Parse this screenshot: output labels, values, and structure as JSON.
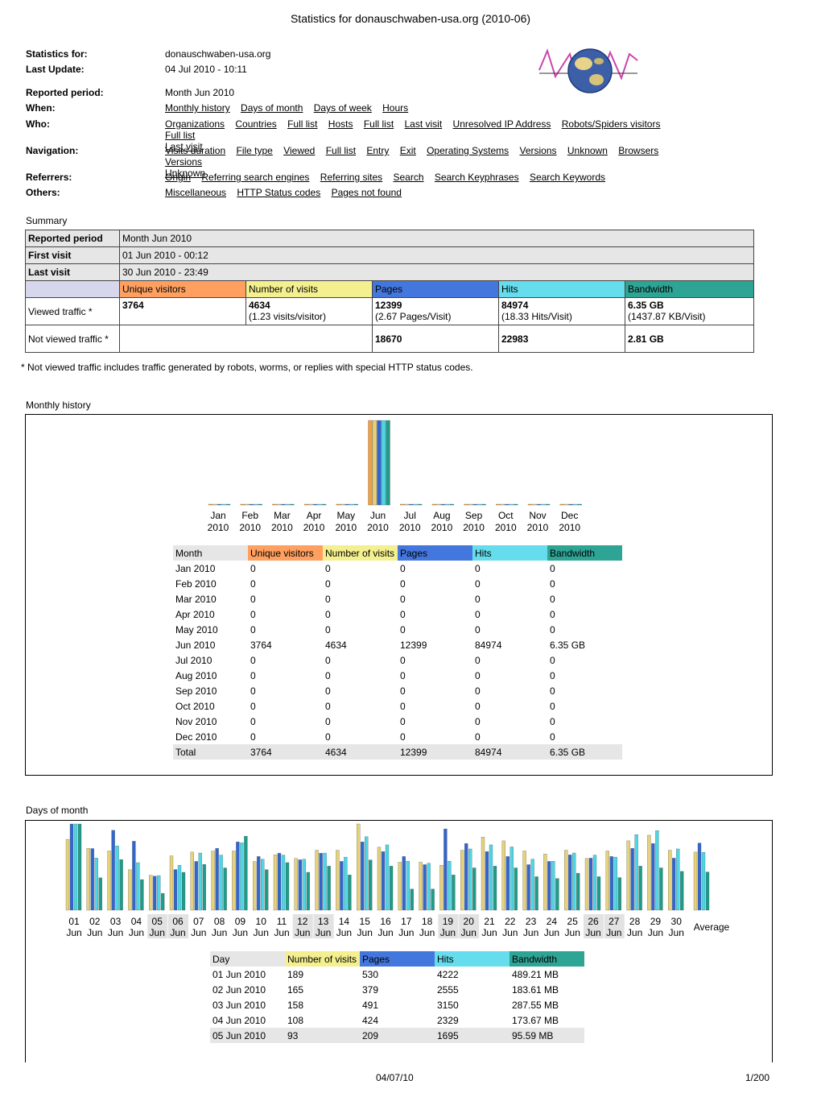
{
  "doc_title": "Statistics for donauschwaben-usa.org (2010-06)",
  "info": {
    "stats_for_label": "Statistics for:",
    "stats_for_value": "donauschwaben-usa.org",
    "last_update_label": "Last Update:",
    "last_update_value": "04 Jul 2010 - 10:11",
    "reported_period_label": "Reported period:",
    "reported_period_value": "Month Jun 2010",
    "when_label": "When:",
    "who_label": "Who:",
    "navigation_label": "Navigation:",
    "referrers_label": "Referrers:",
    "others_label": "Others:"
  },
  "nav": {
    "when": [
      "Monthly history",
      "Days of month",
      "Days of week",
      "Hours"
    ],
    "who": [
      "Organizations",
      "Countries",
      "Full list",
      "Hosts",
      "Full list",
      "Last visit",
      "Unresolved IP Address",
      "Robots/Spiders visitors",
      "Full list",
      "Last visit"
    ],
    "navigation": [
      "Visits duration",
      "File type",
      "Viewed",
      "Full list",
      "Entry",
      "Exit",
      "Operating Systems",
      "Versions",
      "Unknown",
      "Browsers",
      "Versions",
      "Unknown"
    ],
    "referrers": [
      "Origin",
      "Referring search engines",
      "Referring sites",
      "Search",
      "Search Keyphrases",
      "Search Keywords"
    ],
    "others": [
      "Miscellaneous",
      "HTTP Status codes",
      "Pages not found"
    ]
  },
  "summary": {
    "title": "Summary",
    "reported_period_label": "Reported period",
    "reported_period_value": "Month Jun 2010",
    "first_visit_label": "First visit",
    "first_visit_value": "01 Jun 2010 - 00:12",
    "last_visit_label": "Last visit",
    "last_visit_value": "30 Jun 2010 - 23:49",
    "col_uv": "Unique visitors",
    "col_visits": "Number of visits",
    "col_pages": "Pages",
    "col_hits": "Hits",
    "col_bw": "Bandwidth",
    "viewed_label": "Viewed traffic *",
    "viewed": {
      "uv": "3764",
      "visits": "4634",
      "visits_sub": "(1.23 visits/visitor)",
      "pages": "12399",
      "pages_sub": "(2.67 Pages/Visit)",
      "hits": "84974",
      "hits_sub": "(18.33 Hits/Visit)",
      "bw": "6.35 GB",
      "bw_sub": "(1437.87 KB/Visit)"
    },
    "not_viewed_label": "Not viewed traffic *",
    "not_viewed": {
      "pages": "18670",
      "hits": "22983",
      "bw": "2.81 GB"
    },
    "note": "* Not viewed traffic includes traffic generated by robots, worms, or replies with special HTTP status codes."
  },
  "monthly": {
    "title": "Monthly history",
    "headers": [
      "Month",
      "Unique visitors",
      "Number of visits",
      "Pages",
      "Hits",
      "Bandwidth"
    ],
    "rows": [
      [
        "Jan 2010",
        "0",
        "0",
        "0",
        "0",
        "0"
      ],
      [
        "Feb 2010",
        "0",
        "0",
        "0",
        "0",
        "0"
      ],
      [
        "Mar 2010",
        "0",
        "0",
        "0",
        "0",
        "0"
      ],
      [
        "Apr 2010",
        "0",
        "0",
        "0",
        "0",
        "0"
      ],
      [
        "May 2010",
        "0",
        "0",
        "0",
        "0",
        "0"
      ],
      [
        "Jun 2010",
        "3764",
        "4634",
        "12399",
        "84974",
        "6.35 GB"
      ],
      [
        "Jul 2010",
        "0",
        "0",
        "0",
        "0",
        "0"
      ],
      [
        "Aug 2010",
        "0",
        "0",
        "0",
        "0",
        "0"
      ],
      [
        "Sep 2010",
        "0",
        "0",
        "0",
        "0",
        "0"
      ],
      [
        "Oct 2010",
        "0",
        "0",
        "0",
        "0",
        "0"
      ],
      [
        "Nov 2010",
        "0",
        "0",
        "0",
        "0",
        "0"
      ],
      [
        "Dec 2010",
        "0",
        "0",
        "0",
        "0",
        "0"
      ]
    ],
    "total": [
      "Total",
      "3764",
      "4634",
      "12399",
      "84974",
      "6.35 GB"
    ]
  },
  "days": {
    "title": "Days of month",
    "average_label": "Average",
    "headers": [
      "Day",
      "Number of visits",
      "Pages",
      "Hits",
      "Bandwidth"
    ],
    "rows": [
      [
        "01 Jun 2010",
        "189",
        "530",
        "4222",
        "489.21 MB"
      ],
      [
        "02 Jun 2010",
        "165",
        "379",
        "2555",
        "183.61 MB"
      ],
      [
        "03 Jun 2010",
        "158",
        "491",
        "3150",
        "287.55 MB"
      ],
      [
        "04 Jun 2010",
        "108",
        "424",
        "2329",
        "173.67 MB"
      ],
      [
        "05 Jun 2010",
        "93",
        "209",
        "1695",
        "95.59 MB"
      ]
    ]
  },
  "chart_data": [
    {
      "type": "bar",
      "categories": [
        "Jan 2010",
        "Feb 2010",
        "Mar 2010",
        "Apr 2010",
        "May 2010",
        "Jun 2010",
        "Jul 2010",
        "Aug 2010",
        "Sep 2010",
        "Oct 2010",
        "Nov 2010",
        "Dec 2010"
      ],
      "series": [
        {
          "name": "Unique visitors",
          "values": [
            0,
            0,
            0,
            0,
            0,
            3764,
            0,
            0,
            0,
            0,
            0,
            0
          ],
          "color": "#f0a040"
        },
        {
          "name": "Number of visits",
          "values": [
            0,
            0,
            0,
            0,
            0,
            4634,
            0,
            0,
            0,
            0,
            0,
            0
          ],
          "color": "#e6d27a"
        },
        {
          "name": "Pages",
          "values": [
            0,
            0,
            0,
            0,
            0,
            12399,
            0,
            0,
            0,
            0,
            0,
            0
          ],
          "color": "#3366cc"
        },
        {
          "name": "Hits",
          "values": [
            0,
            0,
            0,
            0,
            0,
            84974,
            0,
            0,
            0,
            0,
            0,
            0
          ],
          "color": "#4dd6e6"
        },
        {
          "name": "Bandwidth",
          "values": [
            0,
            0,
            0,
            0,
            0,
            6.35,
            0,
            0,
            0,
            0,
            0,
            0
          ],
          "color": "#1f9b8a"
        }
      ],
      "month_labels": [
        "Jan",
        "Feb",
        "Mar",
        "Apr",
        "May",
        "Jun",
        "Jul",
        "Aug",
        "Sep",
        "Oct",
        "Nov",
        "Dec"
      ],
      "year_label": "2010"
    },
    {
      "type": "bar",
      "categories": [
        "01",
        "02",
        "03",
        "04",
        "05",
        "06",
        "07",
        "08",
        "09",
        "10",
        "11",
        "12",
        "13",
        "14",
        "15",
        "16",
        "17",
        "18",
        "19",
        "20",
        "21",
        "22",
        "23",
        "24",
        "25",
        "26",
        "27",
        "28",
        "29",
        "30",
        "Average"
      ],
      "sub_label": "Jun",
      "weekend_days": [
        "05",
        "06",
        "12",
        "13",
        "19",
        "20",
        "26",
        "27"
      ],
      "series": [
        {
          "name": "Number of visits",
          "values": [
            189,
            165,
            158,
            108,
            93,
            145,
            155,
            158,
            158,
            130,
            148,
            138,
            160,
            160,
            230,
            168,
            128,
            128,
            120,
            160,
            195,
            185,
            158,
            150,
            160,
            138,
            158,
            185,
            200,
            160,
            155
          ],
          "color": "#e6d27a"
        },
        {
          "name": "Pages",
          "values": [
            530,
            379,
            491,
            424,
            209,
            250,
            300,
            380,
            420,
            330,
            350,
            310,
            350,
            300,
            420,
            360,
            330,
            280,
            500,
            410,
            360,
            330,
            280,
            300,
            340,
            320,
            330,
            380,
            410,
            320,
            413
          ],
          "color": "#3366cc"
        },
        {
          "name": "Hits",
          "values": [
            4222,
            2555,
            3150,
            2329,
            1695,
            2200,
            2800,
            2700,
            3300,
            2500,
            2700,
            2500,
            2800,
            2600,
            3600,
            3200,
            2400,
            2300,
            2400,
            3000,
            3200,
            3100,
            2500,
            2400,
            2800,
            2700,
            2600,
            3700,
            3900,
            3000,
            2832
          ],
          "color": "#4dd6e6"
        },
        {
          "name": "Bandwidth",
          "values": [
            489.21,
            183.61,
            287.55,
            173.67,
            95.59,
            215,
            260,
            240,
            420,
            230,
            270,
            215,
            250,
            200,
            285,
            250,
            120,
            120,
            200,
            240,
            250,
            240,
            190,
            180,
            210,
            190,
            185,
            250,
            240,
            220,
            216.75
          ],
          "color": "#1f9b8a"
        }
      ]
    }
  ],
  "footer": {
    "date": "04/07/10",
    "page": "1/200"
  }
}
